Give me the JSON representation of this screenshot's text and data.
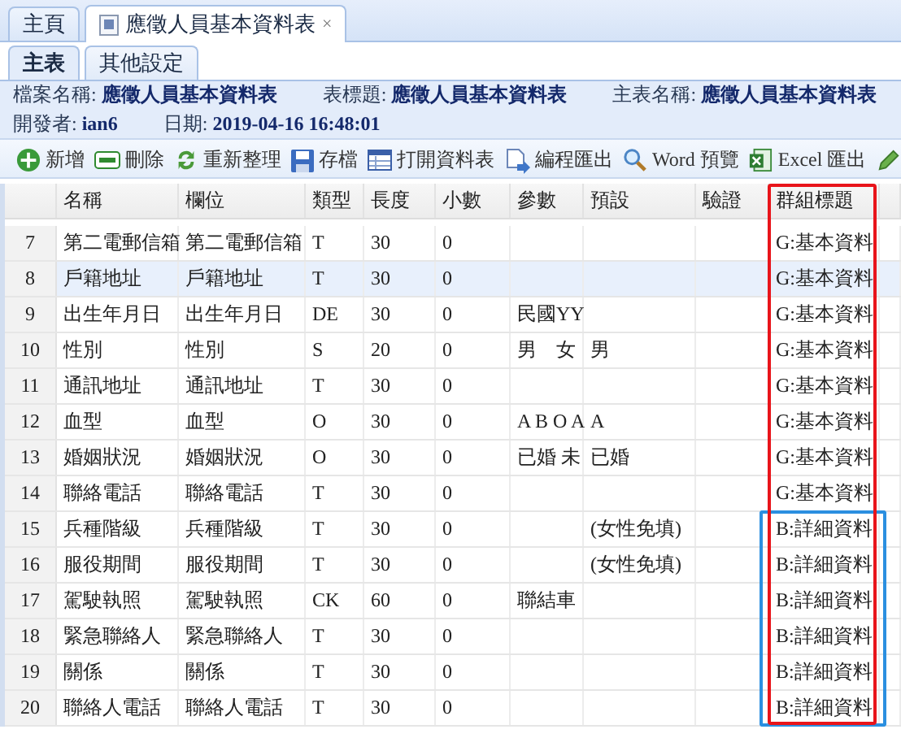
{
  "page_tabs": [
    {
      "label": "主頁",
      "selected": false,
      "icon": false
    },
    {
      "label": "應徵人員基本資料表",
      "selected": true,
      "icon": true,
      "close": "×"
    }
  ],
  "highlight_frames": [
    {
      "color": "#e8141a",
      "kind": "column"
    },
    {
      "color": "#2b8fe0",
      "kind": "rows"
    }
  ],
  "sub_tabs": [
    {
      "label": "主表",
      "selected": true
    },
    {
      "label": "其他設定",
      "selected": false
    }
  ],
  "info": [
    [
      {
        "label": "檔案名稱:",
        "value": "應徵人員基本資料表"
      },
      {
        "label": "表標題:",
        "value": "應徵人員基本資料表"
      },
      {
        "label": "主表名稱:",
        "value": "應徵人員基本資料表"
      }
    ],
    [
      {
        "label": "開發者:",
        "value": "ian6"
      },
      {
        "label": "日期:",
        "value": "2019-04-16 16:48:01"
      }
    ]
  ],
  "toolbar": [
    {
      "kind": "add",
      "label": "新增"
    },
    {
      "kind": "delete",
      "label": "刪除"
    },
    {
      "kind": "refresh",
      "label": "重新整理"
    },
    {
      "kind": "save",
      "label": "存檔"
    },
    {
      "kind": "open",
      "label": "打開資料表"
    },
    {
      "kind": "export",
      "label": "編程匯出"
    },
    {
      "kind": "word",
      "label": "Word 預覽"
    },
    {
      "kind": "excel",
      "label": "Excel 匯出"
    },
    {
      "kind": "edit"
    }
  ],
  "table": {
    "columns": [
      "名稱",
      "欄位",
      "類型",
      "長度",
      "小數",
      "參數",
      "預設",
      "驗證",
      "群組標題"
    ],
    "rows": [
      {
        "num": "7",
        "cells": [
          "第二電郵信箱",
          "第二電郵信箱",
          "T",
          "30",
          "0",
          "",
          "",
          "",
          "G:基本資料"
        ],
        "selected": false,
        "boxed": false
      },
      {
        "num": "8",
        "cells": [
          "戶籍地址",
          "戶籍地址",
          "T",
          "30",
          "0",
          "",
          "",
          "",
          "G:基本資料"
        ],
        "selected": true,
        "boxed": false
      },
      {
        "num": "9",
        "cells": [
          "出生年月日",
          "出生年月日",
          "DE",
          "30",
          "0",
          "民國YY",
          "",
          "",
          "G:基本資料"
        ],
        "selected": false,
        "boxed": false
      },
      {
        "num": "10",
        "cells": [
          "性別",
          "性別",
          "S",
          "20",
          "0",
          "男　女",
          "男",
          "",
          "G:基本資料"
        ],
        "selected": false,
        "boxed": false
      },
      {
        "num": "11",
        "cells": [
          "通訊地址",
          "通訊地址",
          "T",
          "30",
          "0",
          "",
          "",
          "",
          "G:基本資料"
        ],
        "selected": false,
        "boxed": false
      },
      {
        "num": "12",
        "cells": [
          "血型",
          "血型",
          "O",
          "30",
          "0",
          "A B O A",
          "A",
          "",
          "G:基本資料"
        ],
        "selected": false,
        "boxed": false
      },
      {
        "num": "13",
        "cells": [
          "婚姻狀況",
          "婚姻狀況",
          "O",
          "30",
          "0",
          "已婚 未",
          "已婚",
          "",
          "G:基本資料"
        ],
        "selected": false,
        "boxed": false
      },
      {
        "num": "14",
        "cells": [
          "聯絡電話",
          "聯絡電話",
          "T",
          "30",
          "0",
          "",
          "",
          "",
          "G:基本資料"
        ],
        "selected": false,
        "boxed": false
      },
      {
        "num": "15",
        "cells": [
          "兵種階級",
          "兵種階級",
          "T",
          "30",
          "0",
          "",
          "(女性免填)",
          "",
          "B:詳細資料"
        ],
        "selected": false,
        "boxed": true
      },
      {
        "num": "16",
        "cells": [
          "服役期間",
          "服役期間",
          "T",
          "30",
          "0",
          "",
          "(女性免填)",
          "",
          "B:詳細資料"
        ],
        "selected": false,
        "boxed": true
      },
      {
        "num": "17",
        "cells": [
          "駕駛執照",
          "駕駛執照",
          "CK",
          "60",
          "0",
          "聯結車",
          "",
          "",
          "B:詳細資料"
        ],
        "selected": false,
        "boxed": true
      },
      {
        "num": "18",
        "cells": [
          "緊急聯絡人",
          "緊急聯絡人",
          "T",
          "30",
          "0",
          "",
          "",
          "",
          "B:詳細資料"
        ],
        "selected": false,
        "boxed": true
      },
      {
        "num": "19",
        "cells": [
          "關係",
          "關係",
          "T",
          "30",
          "0",
          "",
          "",
          "",
          "B:詳細資料"
        ],
        "selected": false,
        "boxed": true
      },
      {
        "num": "20",
        "cells": [
          "聯絡人電話",
          "聯絡人電話",
          "T",
          "30",
          "0",
          "",
          "",
          "",
          "B:詳細資料"
        ],
        "selected": false,
        "boxed": true
      }
    ]
  }
}
